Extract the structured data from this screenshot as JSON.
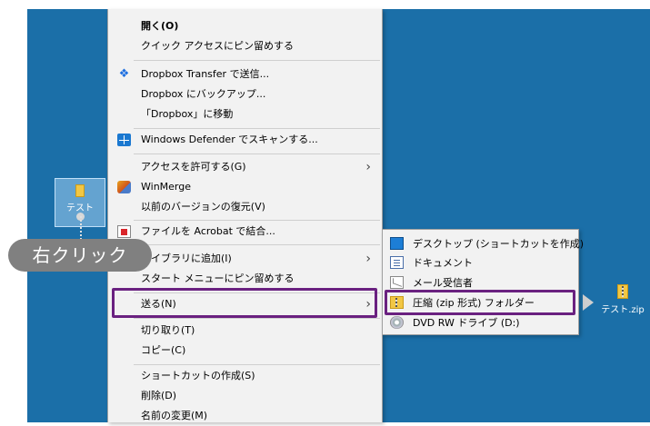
{
  "desktop": {
    "folder_label": "テスト",
    "zip_label": "テスト.zip"
  },
  "callout": {
    "label": "右クリック"
  },
  "context_menu": {
    "items": [
      {
        "label": "開く(O)",
        "bold": true
      },
      {
        "label": "クイック アクセスにピン留めする"
      },
      {
        "label": "Dropbox Transfer で送信...",
        "icon": "dropbox-icon"
      },
      {
        "label": "Dropbox にバックアップ..."
      },
      {
        "label": "「Dropbox」に移動"
      },
      {
        "label": "Windows Defender でスキャンする...",
        "icon": "defender-icon"
      },
      {
        "label": "アクセスを許可する(G)",
        "submenu": true
      },
      {
        "label": "WinMerge",
        "icon": "winmerge-icon"
      },
      {
        "label": "以前のバージョンの復元(V)"
      },
      {
        "label": "ファイルを Acrobat で結合...",
        "icon": "acrobat-icon"
      },
      {
        "label": "ライブラリに追加(I)",
        "submenu": true
      },
      {
        "label": "スタート メニューにピン留めする"
      },
      {
        "label": "送る(N)",
        "submenu": true,
        "highlighted": true
      },
      {
        "label": "切り取り(T)"
      },
      {
        "label": "コピー(C)"
      },
      {
        "label": "ショートカットの作成(S)"
      },
      {
        "label": "削除(D)"
      },
      {
        "label": "名前の変更(M)"
      }
    ]
  },
  "send_to_submenu": {
    "items": [
      {
        "label": "デスクトップ (ショートカットを作成)",
        "icon": "desktop-icon"
      },
      {
        "label": "ドキュメント",
        "icon": "document-icon"
      },
      {
        "label": "メール受信者",
        "icon": "mail-icon"
      },
      {
        "label": "圧縮 (zip 形式) フォルダー",
        "icon": "zip-folder-icon",
        "highlighted": true
      },
      {
        "label": "DVD RW ドライブ (D:)",
        "icon": "dvd-drive-icon"
      }
    ]
  },
  "colors": {
    "desktop_bg": "#1b6fa8",
    "menu_bg": "#f2f2f2",
    "highlight_border": "#6a2180",
    "callout_bg": "#808080"
  }
}
